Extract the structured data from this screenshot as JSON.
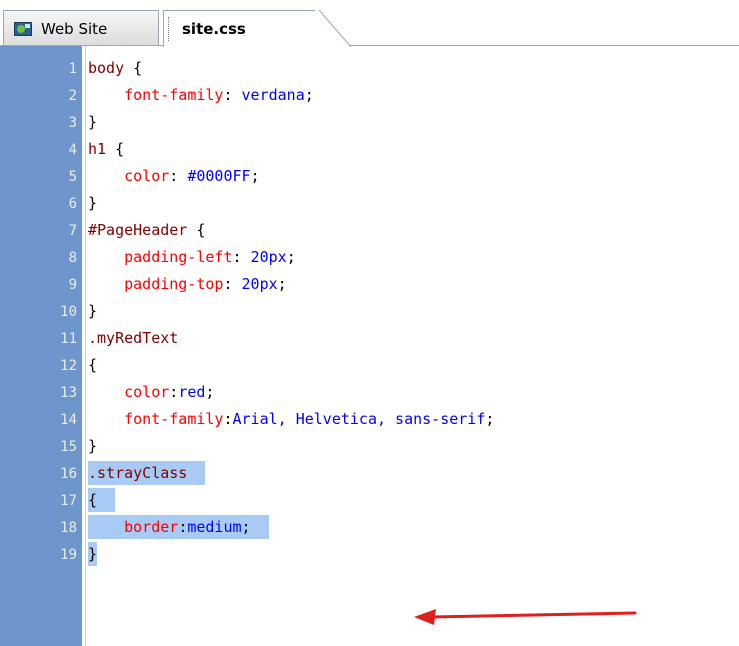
{
  "tabs": [
    {
      "label": "Web Site",
      "icon": "website-icon",
      "active": false
    },
    {
      "label": "site.css",
      "active": true
    }
  ],
  "colors": {
    "selector": "#800000",
    "property": "#ff0000",
    "value": "#0000ff",
    "selection": "#a7cbf5",
    "gutter": "#6e96cc",
    "annotation_arrow": "#dd1f1f"
  },
  "editor": {
    "lines": [
      {
        "num": "1",
        "tokens": [
          {
            "t": "body",
            "k": "sel"
          },
          {
            "t": " {",
            "k": "pun"
          }
        ]
      },
      {
        "num": "2",
        "tokens": [
          {
            "t": "    ",
            "k": "pun"
          },
          {
            "t": "font-family",
            "k": "prop"
          },
          {
            "t": ": ",
            "k": "pun"
          },
          {
            "t": "verdana",
            "k": "val"
          },
          {
            "t": ";",
            "k": "pun"
          }
        ]
      },
      {
        "num": "3",
        "tokens": [
          {
            "t": "}",
            "k": "pun"
          }
        ]
      },
      {
        "num": "4",
        "tokens": [
          {
            "t": "h1",
            "k": "sel"
          },
          {
            "t": " {",
            "k": "pun"
          }
        ]
      },
      {
        "num": "5",
        "tokens": [
          {
            "t": "    ",
            "k": "pun"
          },
          {
            "t": "color",
            "k": "prop"
          },
          {
            "t": ": ",
            "k": "pun"
          },
          {
            "t": "#0000FF",
            "k": "val"
          },
          {
            "t": ";",
            "k": "pun"
          }
        ]
      },
      {
        "num": "6",
        "tokens": [
          {
            "t": "}",
            "k": "pun"
          }
        ]
      },
      {
        "num": "7",
        "tokens": [
          {
            "t": "#PageHeader",
            "k": "sel"
          },
          {
            "t": " {",
            "k": "pun"
          }
        ]
      },
      {
        "num": "8",
        "tokens": [
          {
            "t": "    ",
            "k": "pun"
          },
          {
            "t": "padding-left",
            "k": "prop"
          },
          {
            "t": ": ",
            "k": "pun"
          },
          {
            "t": "20px",
            "k": "val"
          },
          {
            "t": ";",
            "k": "pun"
          }
        ]
      },
      {
        "num": "9",
        "tokens": [
          {
            "t": "    ",
            "k": "pun"
          },
          {
            "t": "padding-top",
            "k": "prop"
          },
          {
            "t": ": ",
            "k": "pun"
          },
          {
            "t": "20px",
            "k": "val"
          },
          {
            "t": ";",
            "k": "pun"
          }
        ]
      },
      {
        "num": "10",
        "tokens": [
          {
            "t": "}",
            "k": "pun"
          }
        ]
      },
      {
        "num": "11",
        "tokens": [
          {
            "t": ".myRedText",
            "k": "sel"
          }
        ]
      },
      {
        "num": "12",
        "tokens": [
          {
            "t": "{",
            "k": "pun"
          }
        ]
      },
      {
        "num": "13",
        "tokens": [
          {
            "t": "    ",
            "k": "pun"
          },
          {
            "t": "color",
            "k": "prop"
          },
          {
            "t": ":",
            "k": "pun"
          },
          {
            "t": "red",
            "k": "val"
          },
          {
            "t": ";",
            "k": "pun"
          }
        ]
      },
      {
        "num": "14",
        "tokens": [
          {
            "t": "    ",
            "k": "pun"
          },
          {
            "t": "font-family",
            "k": "prop"
          },
          {
            "t": ":",
            "k": "pun"
          },
          {
            "t": "Arial, Helvetica, sans-serif",
            "k": "val"
          },
          {
            "t": ";",
            "k": "pun"
          }
        ]
      },
      {
        "num": "15",
        "tokens": [
          {
            "t": "}",
            "k": "pun"
          }
        ]
      },
      {
        "num": "16",
        "selected": true,
        "tokens": [
          {
            "t": ".strayClass",
            "k": "sel"
          },
          {
            "t": "  ",
            "k": "pun"
          }
        ]
      },
      {
        "num": "17",
        "selected": true,
        "tokens": [
          {
            "t": "{",
            "k": "pun"
          },
          {
            "t": "  ",
            "k": "pun"
          }
        ]
      },
      {
        "num": "18",
        "selected": true,
        "tokens": [
          {
            "t": "    ",
            "k": "pun"
          },
          {
            "t": "border",
            "k": "prop"
          },
          {
            "t": ":",
            "k": "pun"
          },
          {
            "t": "medium",
            "k": "val"
          },
          {
            "t": ";",
            "k": "pun"
          },
          {
            "t": "  ",
            "k": "pun"
          }
        ]
      },
      {
        "num": "19",
        "selected": true,
        "tokens": [
          {
            "t": "}",
            "k": "pun"
          }
        ]
      }
    ]
  }
}
